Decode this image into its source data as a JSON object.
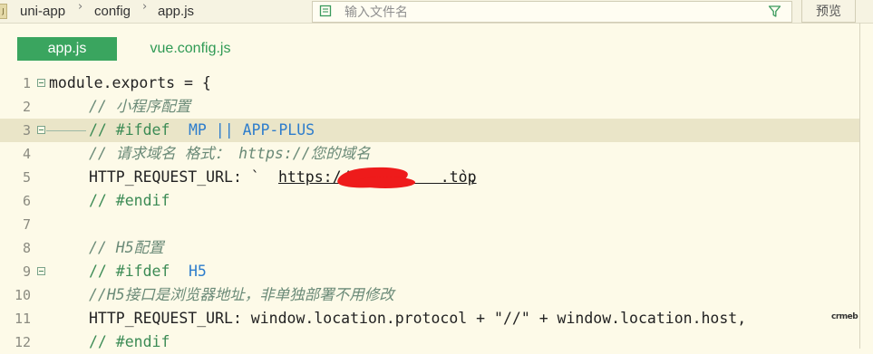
{
  "breadcrumb": [
    "uni-app",
    "config",
    "app.js"
  ],
  "search": {
    "placeholder": "输入文件名",
    "value": ""
  },
  "preview_label": "预览",
  "tabs": [
    {
      "label": "app.js",
      "active": true
    },
    {
      "label": "vue.config.js",
      "active": false
    }
  ],
  "editor": {
    "highlighted_line": 3,
    "lines": [
      {
        "num": "1",
        "text": "module.exports = {"
      },
      {
        "num": "2",
        "text": "// 小程序配置"
      },
      {
        "num": "3",
        "text": "// #ifdef MP || APP-PLUS"
      },
      {
        "num": "4",
        "text": "// 请求域名 格式： https://您的域名"
      },
      {
        "num": "5",
        "text": "HTTP_REQUEST_URL: `https://██████.top`,"
      },
      {
        "num": "6",
        "text": "// #endif"
      },
      {
        "num": "7",
        "text": ""
      },
      {
        "num": "8",
        "text": "// H5配置"
      },
      {
        "num": "9",
        "text": "// #ifdef H5"
      },
      {
        "num": "10",
        "text": "//H5接口是浏览器地址，非单独部署不用修改"
      },
      {
        "num": "11",
        "text": "HTTP_REQUEST_URL: window.location.protocol + \"//\" + window.location.host,"
      },
      {
        "num": "12",
        "text": "// #endif"
      }
    ],
    "tokens": {
      "l1": "module.exports = {",
      "l2": "// 小程序配置",
      "l3_a": "// #ifdef ",
      "l3_b": "MP || APP-PLUS",
      "l4": "// 请求域名 格式： https://您的域名",
      "l5_a": "HTTP_REQUEST_URL: `",
      "l5_url": "https://          .top",
      "l5_b": "`,",
      "l6": "// #endif",
      "l8": "// H5配置",
      "l9_a": "// #ifdef ",
      "l9_b": "H5",
      "l10": "//H5接口是浏览器地址，非单独部署不用修改",
      "l11": "HTTP_REQUEST_URL: window.location.protocol + \"//\" + window.location.host,",
      "l12": "// #endif"
    }
  },
  "watermark": "crmeb",
  "colors": {
    "background": "#fdfae8",
    "tab_active": "#3aa55f",
    "keyword": "#2e7dcc",
    "comment": "#3c8b55",
    "line_highlight": "#eae5c8",
    "redaction": "#ee1b1b"
  }
}
